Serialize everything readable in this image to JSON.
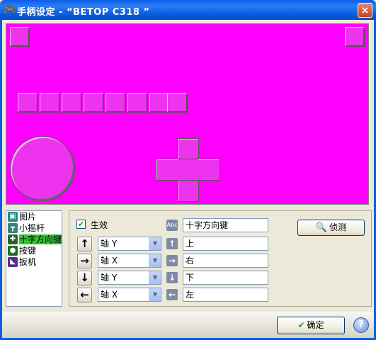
{
  "window": {
    "title": "手柄设定 - “BETOP C318 ”",
    "app_icon": "gamepad-icon",
    "close_label": "×"
  },
  "preview": {
    "background": "#ff00ff",
    "button_fill": "#ee33ee"
  },
  "category_list": {
    "items": [
      {
        "label": "图片",
        "icon": "picture-icon",
        "icon_color": "#1f8b8b",
        "icon_glyph": "▣"
      },
      {
        "label": "小摇杆",
        "icon": "joystick-icon",
        "icon_color": "#3a7f7f",
        "icon_glyph": "┳"
      },
      {
        "label": "十字方向键",
        "icon": "dpad-icon",
        "icon_color": "#2d5f2d",
        "icon_glyph": "✚"
      },
      {
        "label": "按键",
        "icon": "button-icon",
        "icon_color": "#1e6f1e",
        "icon_glyph": "●"
      },
      {
        "label": "扳机",
        "icon": "trigger-icon",
        "icon_color": "#5a2a8a",
        "icon_glyph": "◣"
      }
    ],
    "selected_index": 2,
    "selected_color": "#31c531"
  },
  "settings": {
    "enabled_label": "生效",
    "enabled_checked": true,
    "name_icon_text": "Abc",
    "name_value": "十字方向键",
    "detect_label": "侦测",
    "rows": [
      {
        "arrow": "↑",
        "axis": "轴 Y",
        "dir_icon": "↑",
        "dir_value": "上"
      },
      {
        "arrow": "→",
        "axis": "轴 X",
        "dir_icon": "→",
        "dir_value": "右"
      },
      {
        "arrow": "↓",
        "axis": "轴 Y",
        "dir_icon": "↓",
        "dir_value": "下"
      },
      {
        "arrow": "←",
        "axis": "轴 X",
        "dir_icon": "←",
        "dir_value": "左"
      }
    ]
  },
  "footer": {
    "ok_label": "确定",
    "help_label": "?"
  }
}
